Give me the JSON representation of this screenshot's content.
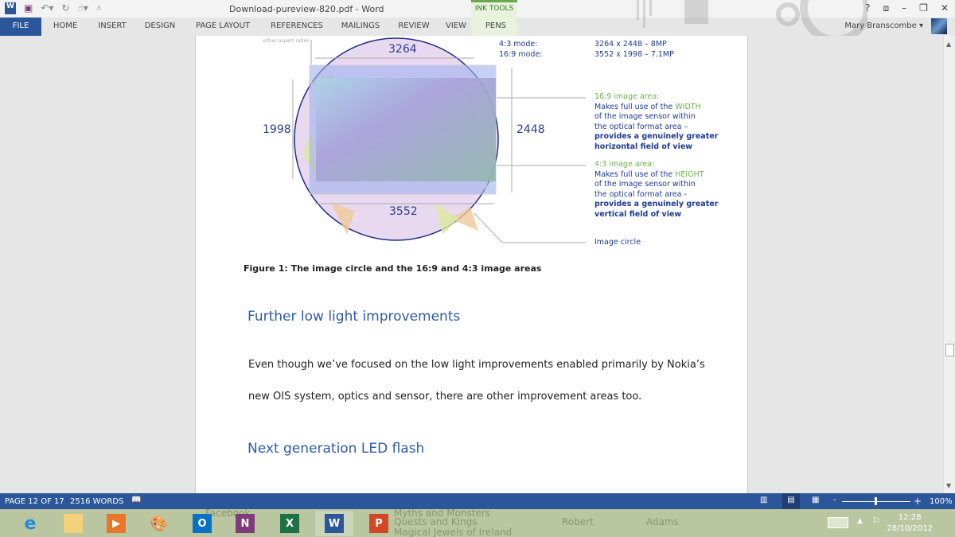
{
  "window": {
    "title": "Download-pureview-820.pdf - Word",
    "contextual_group": "INK TOOLS",
    "user": "Mary Branscombe"
  },
  "ribbon": {
    "tabs": [
      "FILE",
      "HOME",
      "INSERT",
      "DESIGN",
      "PAGE LAYOUT",
      "REFERENCES",
      "MAILINGS",
      "REVIEW",
      "VIEW",
      "PENS"
    ]
  },
  "window_controls": {
    "help": "?",
    "ribbon_display": "⧈",
    "minimize": "–",
    "restore": "❐",
    "close": "✕"
  },
  "figure": {
    "corner_note": "either aspect ratios",
    "dim_top": "3264",
    "dim_bottom": "3552",
    "dim_left": "1998",
    "dim_right": "2448",
    "modes": [
      {
        "label": "4:3 mode:",
        "value": "3264 x 2448 – 8MP"
      },
      {
        "label": "16:9 mode:",
        "value": "3552 x 1998 – 7.1MP"
      }
    ],
    "area169": {
      "title": "16:9 image area:",
      "l1a": "Makes full use of the ",
      "l1b": "WIDTH",
      "l2": "of the image sensor within",
      "l3": "the optical format area –",
      "l4": "provides a genuinely greater",
      "l5": "horizontal field of view"
    },
    "area43": {
      "title": "4:3 image area:",
      "l1a": "Makes full use of the ",
      "l1b": "HEIGHT",
      "l2": "of the image sensor within",
      "l3": "the optical format area -",
      "l4": "provides a genuinely greater",
      "l5": "vertical field of view"
    },
    "image_circle": "Image circle",
    "colors": {
      "circle": "#1f2f86",
      "text": "#1f3a93",
      "accent": "#6ab04c"
    }
  },
  "document": {
    "caption": "Figure 1: The image circle and the 16:9 and 4:3 image areas",
    "heading1": "Further low light improvements",
    "para1_line1": "Even though we’ve focused on the low light improvements enabled primarily by Nokia’s",
    "para1_line2": "new OIS system, optics and sensor, there are other improvement areas too.",
    "heading2": "Next generation LED flash"
  },
  "status": {
    "page": "PAGE 12 OF 17",
    "words": "2516 WORDS",
    "zoom": "100%",
    "zoom_level": 100
  },
  "taskbar": {
    "apps": [
      "internet-explorer",
      "file-explorer",
      "media-player",
      "paint",
      "outlook",
      "onenote",
      "excel",
      "word",
      "powerpoint"
    ],
    "background_text": [
      "Facebook",
      "Quests and Kings",
      "Robert",
      "Adams",
      "Myths and Monsters",
      "Magical Jewels of Ireland"
    ],
    "time": "12:28",
    "date": "28/10/2012"
  }
}
